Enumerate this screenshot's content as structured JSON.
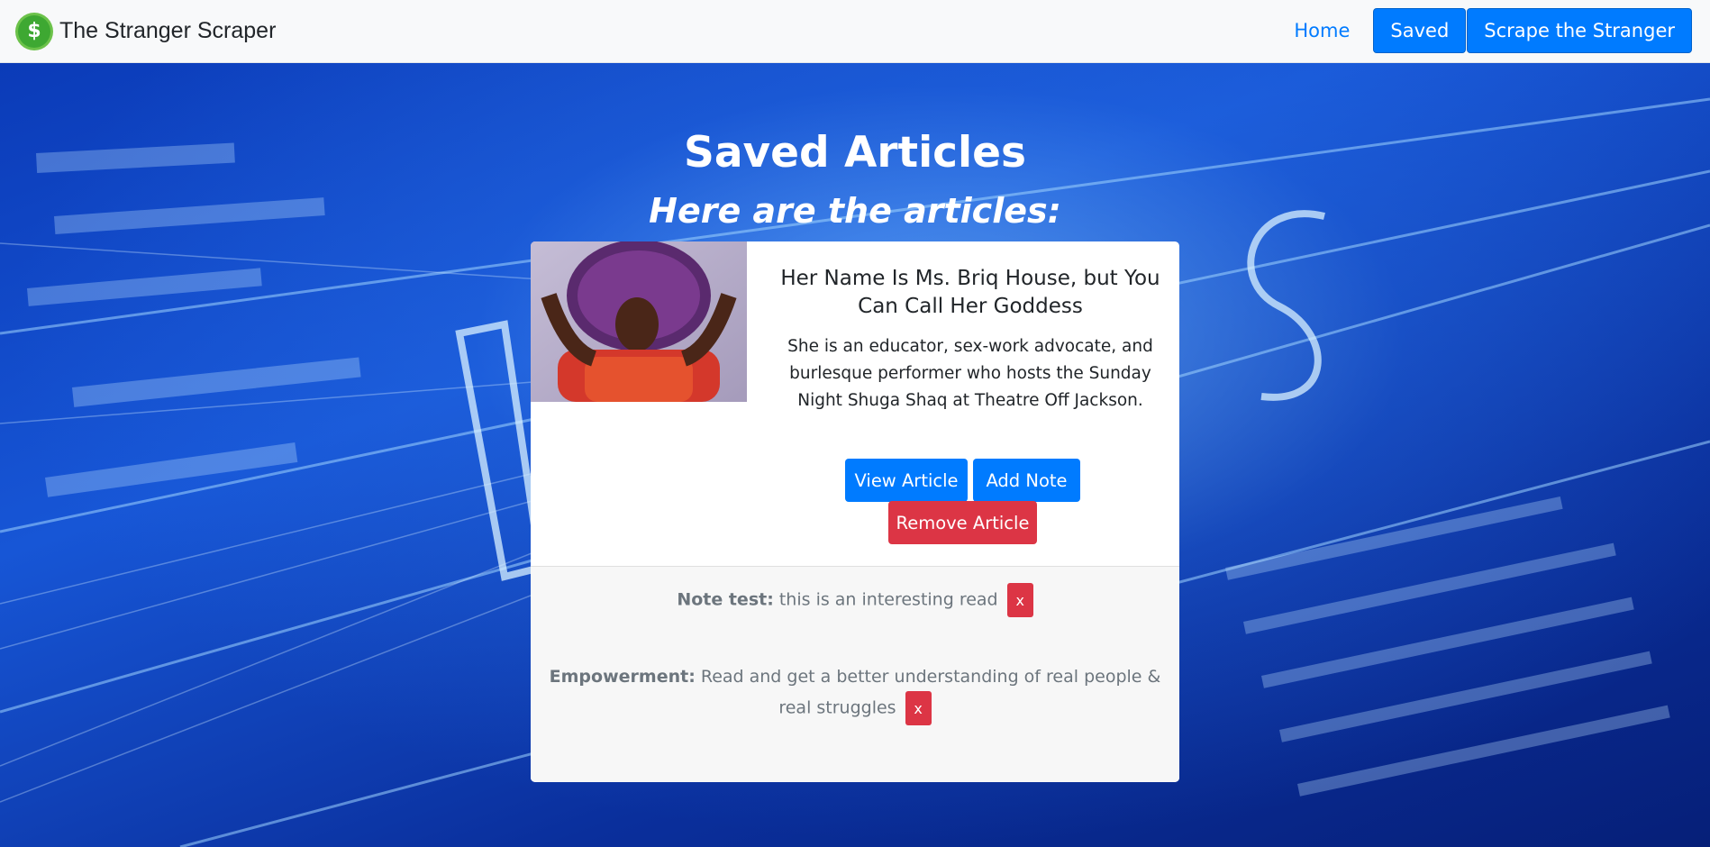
{
  "navbar": {
    "brand_icon": "dollar-badge-icon",
    "brand": "The Stranger Scraper",
    "home": "Home",
    "saved": "Saved",
    "scrape": "Scrape the Stranger"
  },
  "page": {
    "title": "Saved Articles",
    "subtitle": "Here are the articles:"
  },
  "article": {
    "title": "Her Name Is Ms. Briq House, but You Can Call Her Goddess",
    "summary": "She is an educator, sex-work advocate, and burlesque performer who hosts the Sunday Night Shuga Shaq at Theatre Off Jackson.",
    "view_button": "View Article",
    "add_note_button": "Add Note",
    "remove_button": "Remove Article",
    "notes": [
      {
        "title": "Note test:",
        "body": "this is an interesting read",
        "delete": "x"
      },
      {
        "title": "Empowerment:",
        "body": "Read and get a better understanding of real people & real struggles",
        "delete": "x"
      }
    ]
  },
  "colors": {
    "primary": "#007bff",
    "danger": "#dc3545",
    "navbar_bg": "#f8f9fa",
    "background": "#0b3bb8"
  }
}
